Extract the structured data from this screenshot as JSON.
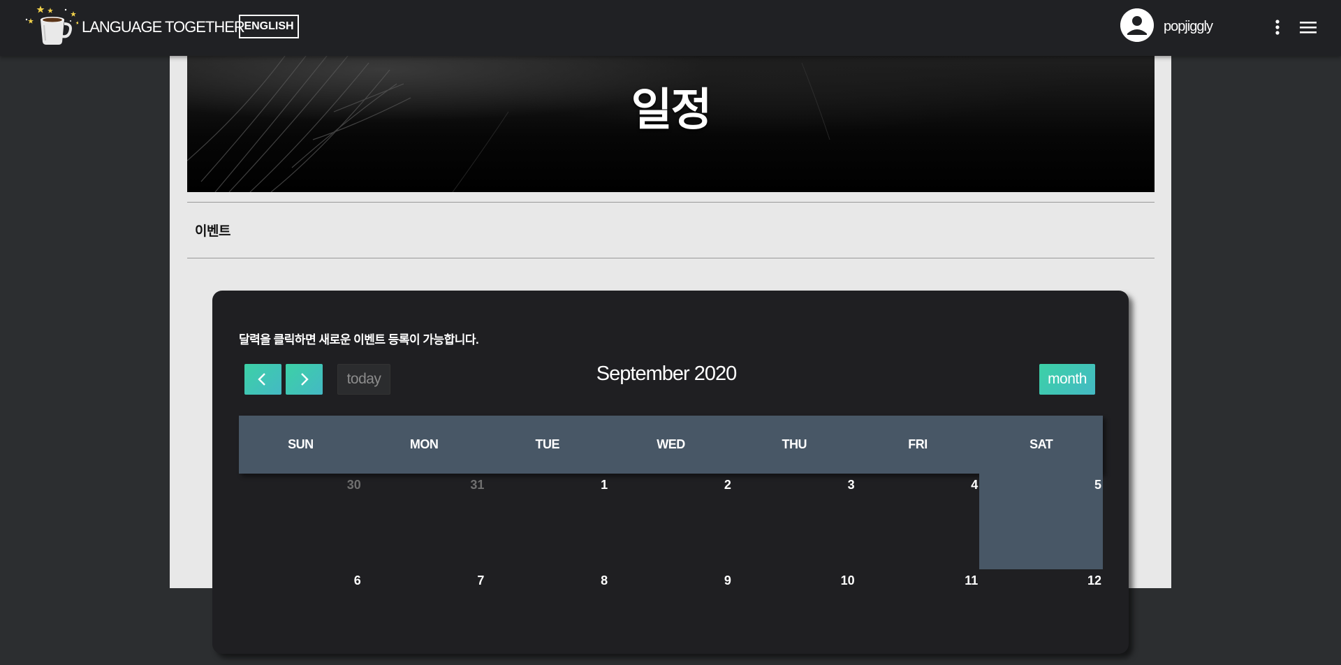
{
  "header": {
    "brand": "LANGUAGE TOGETHER",
    "language_button": "ENGLISH",
    "username": "popjiggly",
    "icons": [
      "coffee-logo-icon",
      "avatar-icon",
      "more-vert-icon",
      "menu-icon"
    ]
  },
  "hero": {
    "title": "일정"
  },
  "subnav": {
    "label": "이벤트"
  },
  "calendar": {
    "hint": "달력을 클릭하면 새로운 이벤트 등록이 가능합니다.",
    "title": "September 2020",
    "today_label": "today",
    "month_label": "month",
    "weekdays": [
      "SUN",
      "MON",
      "TUE",
      "WED",
      "THU",
      "FRI",
      "SAT"
    ],
    "weeks": [
      [
        "30",
        "31",
        "1",
        "2",
        "3",
        "4",
        "5"
      ],
      [
        "6",
        "7",
        "8",
        "9",
        "10",
        "11",
        "12"
      ]
    ],
    "accent_color": "#3cd1a6",
    "header_color": "#485766"
  }
}
